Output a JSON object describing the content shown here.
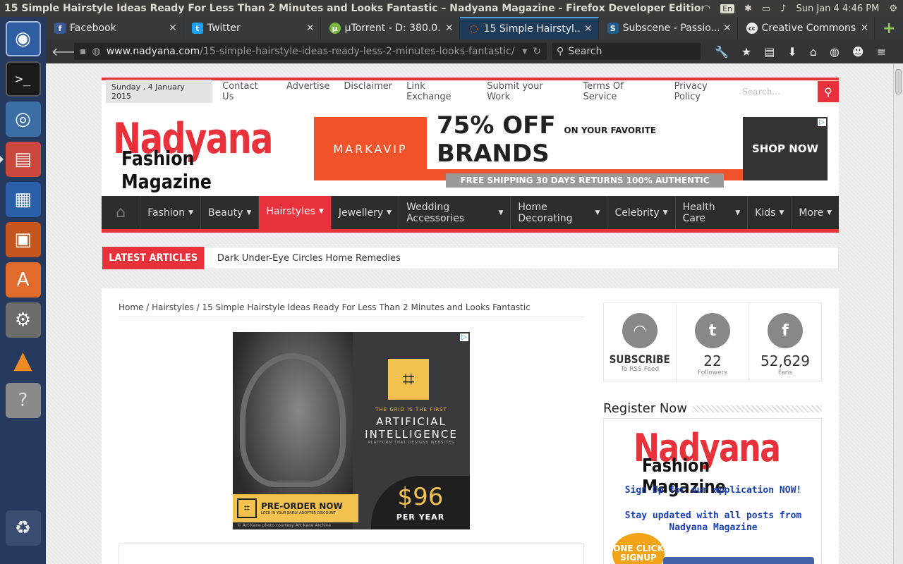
{
  "system": {
    "window_title": "15 Simple Hairstyle Ideas Ready For Less Than 2 Minutes and Looks Fantastic – Nadyana Magazine - Firefox Developer Edition",
    "keyboard": "En",
    "clock": "Sun Jan  4  4:46 PM"
  },
  "launcher": {
    "items": [
      "ubuntu-logo",
      "terminal",
      "chromium",
      "file-manager",
      "libreoffice-writer",
      "libreoffice-impress",
      "ubuntu-software",
      "system-settings",
      "vlc",
      "help",
      "trash"
    ]
  },
  "tabs": [
    {
      "label": "Facebook",
      "icon": "f",
      "color": "#3b5998"
    },
    {
      "label": "Twitter",
      "icon": "t",
      "color": "#1da1f2"
    },
    {
      "label": "µTorrent - D: 380.0...",
      "icon": "µ",
      "color": "#78b83c"
    },
    {
      "label": "15 Simple Hairstyl...",
      "icon": "◌",
      "color": "#e66000"
    },
    {
      "label": "Subscene - Passio...",
      "icon": "S",
      "color": "#215e8c"
    },
    {
      "label": "Creative Commons",
      "icon": "cc",
      "color": "#eeeeee"
    }
  ],
  "navbar": {
    "url_domain": "www.nadyana.com",
    "url_path": "/15-simple-hairstyle-ideas-ready-less-2-minutes-looks-fantastic/",
    "search_placeholder": "Search"
  },
  "site": {
    "date": "Sunday , 4 January 2015",
    "top_links": [
      "Contact Us",
      "Advertise",
      "Disclaimer",
      "Link Exchange",
      "Submit your Work",
      "Terms Of Service",
      "Privacy Policy"
    ],
    "search_placeholder": "Search...",
    "logo_line1": "Nadyana",
    "logo_line2": "Fashion Magazine",
    "ad1": {
      "brand": "MARKAVIP",
      "headline": "75% OFF",
      "small": "ON YOUR FAVORITE",
      "brands": "BRANDS",
      "strip": "FREE SHIPPING  30 DAYS RETURNS  100% AUTHENTIC",
      "cta": "SHOP NOW"
    },
    "nav": [
      "Fashion",
      "Beauty",
      "Hairstyles",
      "Jewellery",
      "Wedding Accessories",
      "Home Decorating",
      "Celebrity",
      "Health Care",
      "Kids",
      "More"
    ],
    "nav_active": "Hairstyles",
    "latest_label": "LATEST ARTICLES",
    "latest_text": "Dark Under-Eye Circles Home Remedies",
    "breadcrumb": [
      "Home",
      "Hairstyles",
      "15 Simple Hairstyle Ideas Ready For Less Than 2 Minutes and Looks Fantastic"
    ],
    "ad2": {
      "tag": "THE GRID IS THE FIRST",
      "headline": "ARTIFICIAL INTELLIGENCE",
      "sub": "PLATFORM THAT DESIGNS WEBSITES",
      "preorder": "PRE-ORDER NOW",
      "preorder_sub": "LOCK IN YOUR EARLY ADOPTER DISCOUNT",
      "price": "$96",
      "per": "PER YEAR",
      "credit": "© Art Kane  photo courtesy Art Kane Archive"
    },
    "social": [
      {
        "icon": "rss-icon",
        "glyph": "◠",
        "value": "SUBSCRIBE",
        "label": "To RSS Feed"
      },
      {
        "icon": "twitter-icon",
        "glyph": "t",
        "value": "22",
        "label": "Followers"
      },
      {
        "icon": "facebook-icon",
        "glyph": "f",
        "value": "52,629",
        "label": "Fans"
      }
    ],
    "register_title": "Register Now",
    "register_line1": "Sign Up for our application NOW!",
    "register_line2": "Stay updated with all posts from",
    "register_line3": "Nadyana Magazine",
    "oneclick": "ONE CLICK SIGNUP"
  },
  "colors": {
    "accent": "#e8313a",
    "nav_bg": "#2d2d2d"
  }
}
